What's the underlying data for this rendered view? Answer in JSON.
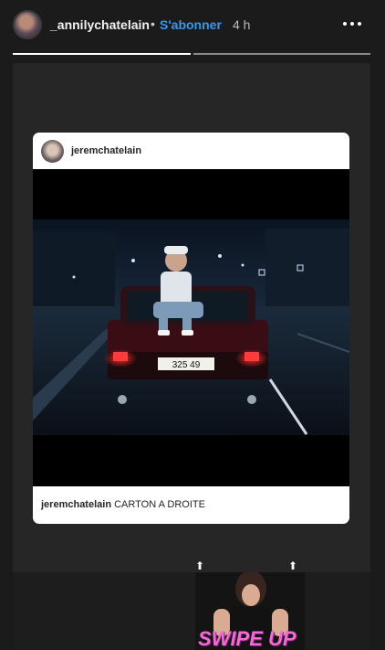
{
  "header": {
    "username": "_annilychatelain",
    "separator": "•",
    "follow_label": "S'abonner",
    "time": "4 h",
    "more_icon": "more-horizontal-icon"
  },
  "progress": {
    "segments": 2,
    "active_fraction": 1.0
  },
  "post": {
    "username": "jeremchatelain",
    "caption_user": "jeremchatelain",
    "caption_text": "CARTON A DROITE",
    "plate": "325  49"
  },
  "sticker": {
    "label": "SWIPE UP",
    "arrow": "⬆"
  },
  "colors": {
    "follow": "#3897f0",
    "swipe": "#f06bd4",
    "background": "#1b1b1b"
  }
}
